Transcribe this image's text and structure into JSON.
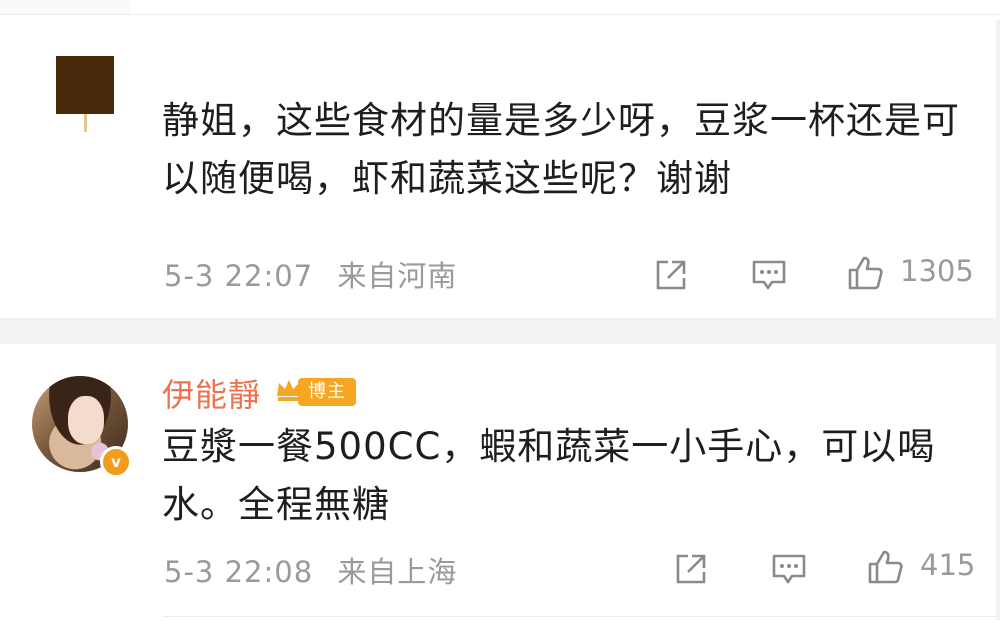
{
  "comments": [
    {
      "text_lines": [
        "静姐，这些食材的量是多少呀，豆浆一杯还是可",
        "以随便喝，虾和蔬菜这些呢？谢谢"
      ],
      "time": "5-3 22:07",
      "location": "来自河南",
      "likes": "1305",
      "icons": {
        "share": "share-icon",
        "comment": "comment-icon",
        "like": "thumbs-up-icon"
      }
    },
    {
      "username": "伊能靜",
      "badge": "博主",
      "verified_mark": "v",
      "text_lines": [
        "豆漿一餐500CC，蝦和蔬菜一小手心，可以喝",
        "水。全程無糖"
      ],
      "time": "5-3 22:08",
      "location": "来自上海",
      "likes": "415",
      "icons": {
        "share": "share-icon",
        "comment": "comment-icon",
        "like": "thumbs-up-icon"
      }
    }
  ],
  "colors": {
    "username": "#eb7350",
    "meta": "#9a9a9a",
    "badge": "#f5a623",
    "separator": "#f2f2f2"
  }
}
